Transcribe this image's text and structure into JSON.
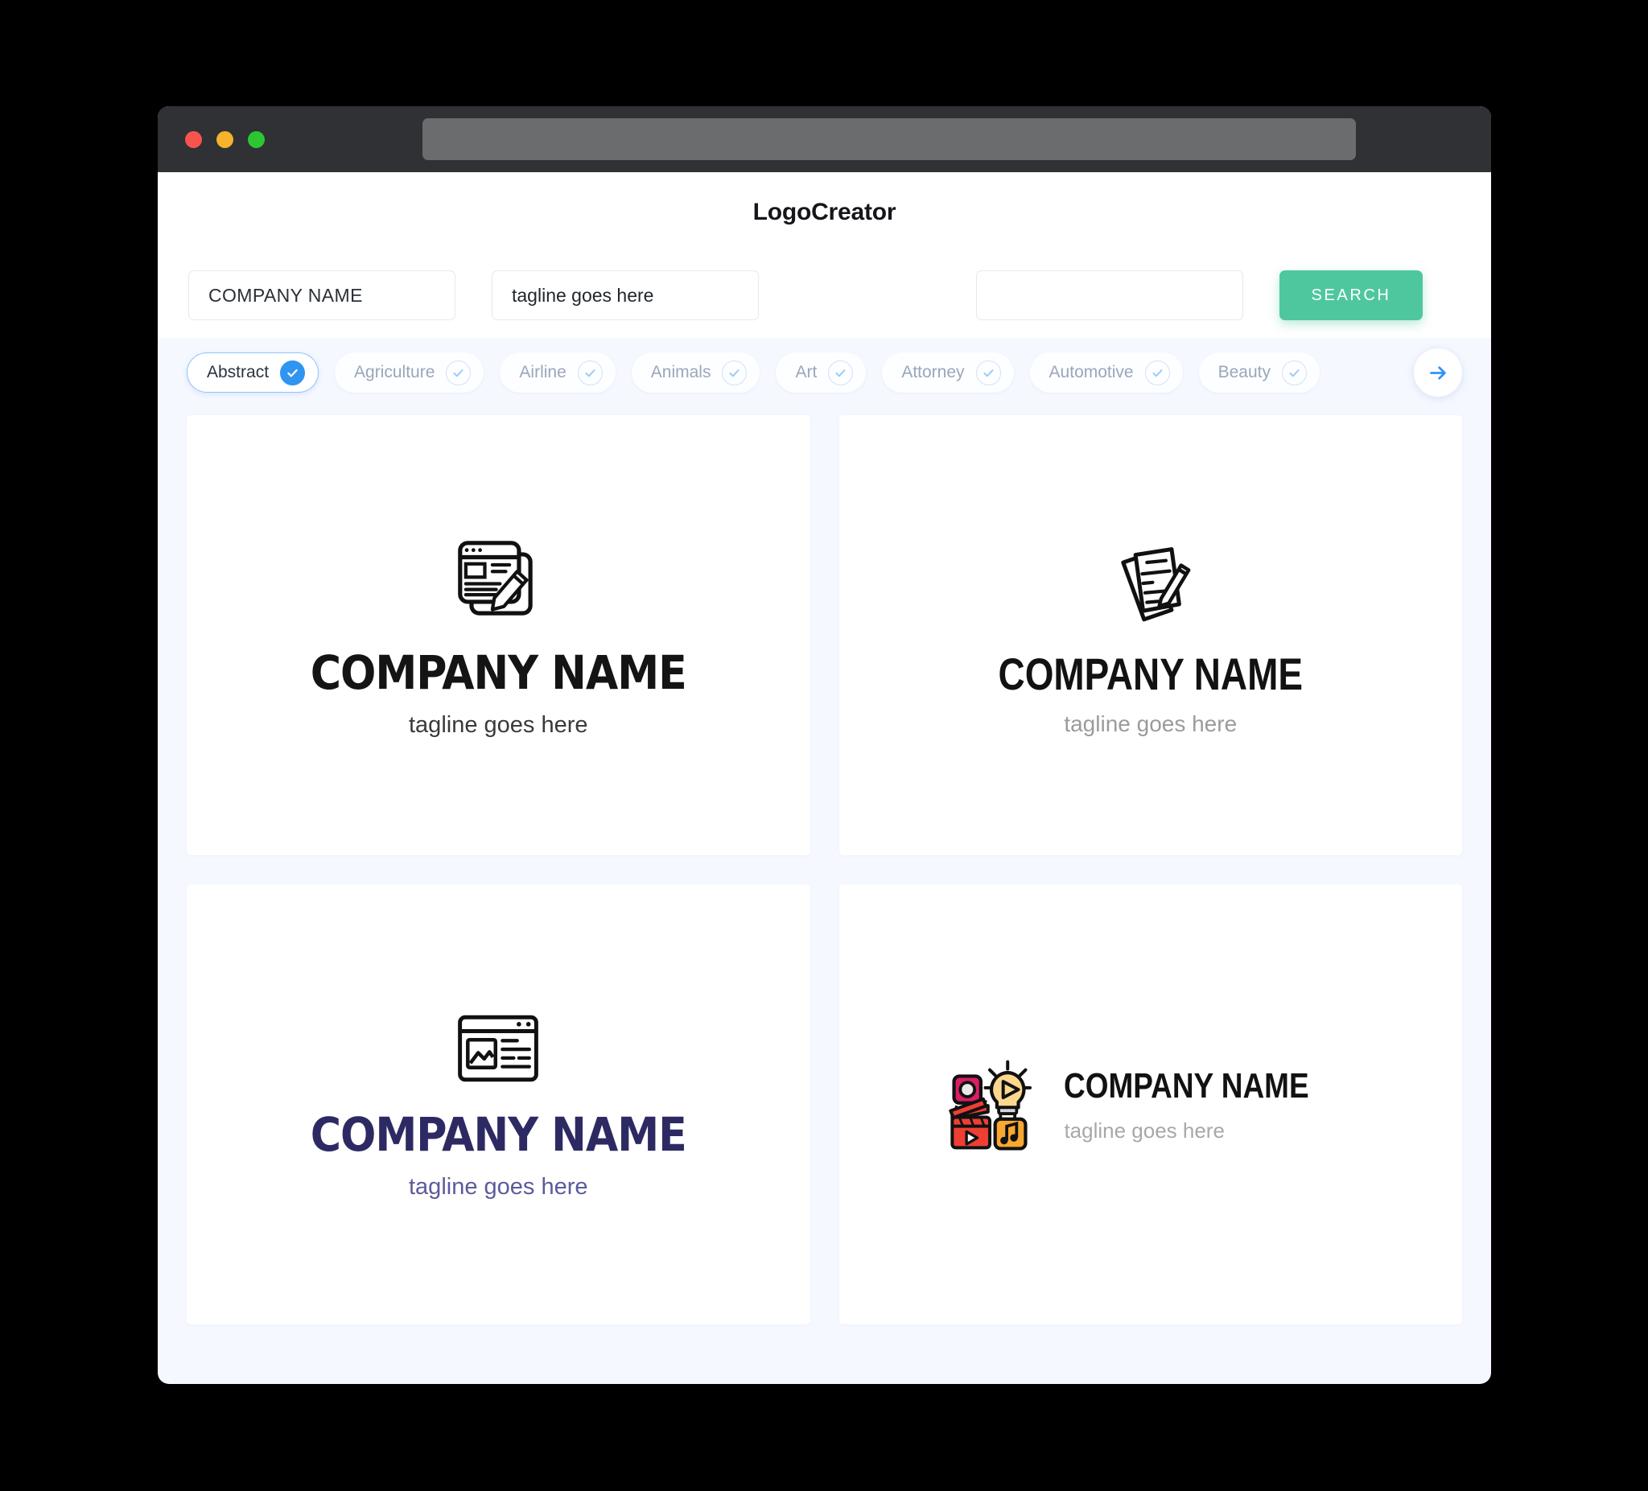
{
  "window": {
    "traffic_lights": [
      "close",
      "minimize",
      "maximize"
    ],
    "url_value": ""
  },
  "header": {
    "title": "LogoCreator"
  },
  "search": {
    "company_value": "COMPANY NAME",
    "company_placeholder": "COMPANY NAME",
    "tagline_value": "tagline goes here",
    "tagline_placeholder": "tagline goes here",
    "extra_value": "",
    "extra_placeholder": "",
    "button_label": "SEARCH",
    "button_color": "#4ec79f"
  },
  "categories": {
    "selected": "Abstract",
    "next_label": "→",
    "items": [
      {
        "label": "Abstract",
        "selected": true
      },
      {
        "label": "Agriculture",
        "selected": false
      },
      {
        "label": "Airline",
        "selected": false
      },
      {
        "label": "Animals",
        "selected": false
      },
      {
        "label": "Art",
        "selected": false
      },
      {
        "label": "Attorney",
        "selected": false
      },
      {
        "label": "Automotive",
        "selected": false
      },
      {
        "label": "Beauty",
        "selected": false
      }
    ]
  },
  "logos": [
    {
      "icon": "browser-window-pencil-icon",
      "name": "COMPANY NAME",
      "tagline": "tagline goes here",
      "name_color": "#141414",
      "tagline_color": "#3a3a3a",
      "layout": "stacked"
    },
    {
      "icon": "documents-pencil-icon",
      "name": "COMPANY NAME",
      "tagline": "tagline goes here",
      "name_color": "#121212",
      "tagline_color": "#9b9b9b",
      "layout": "stacked"
    },
    {
      "icon": "browser-window-image-icon",
      "name": "COMPANY NAME",
      "tagline": "tagline goes here",
      "name_color": "#2d2a63",
      "tagline_color": "#5b5b9c",
      "layout": "stacked"
    },
    {
      "icon": "media-lightbulb-icon",
      "name": "COMPANY NAME",
      "tagline": "tagline goes here",
      "name_color": "#121212",
      "tagline_color": "#a8a8a8",
      "layout": "horizontal"
    }
  ]
}
